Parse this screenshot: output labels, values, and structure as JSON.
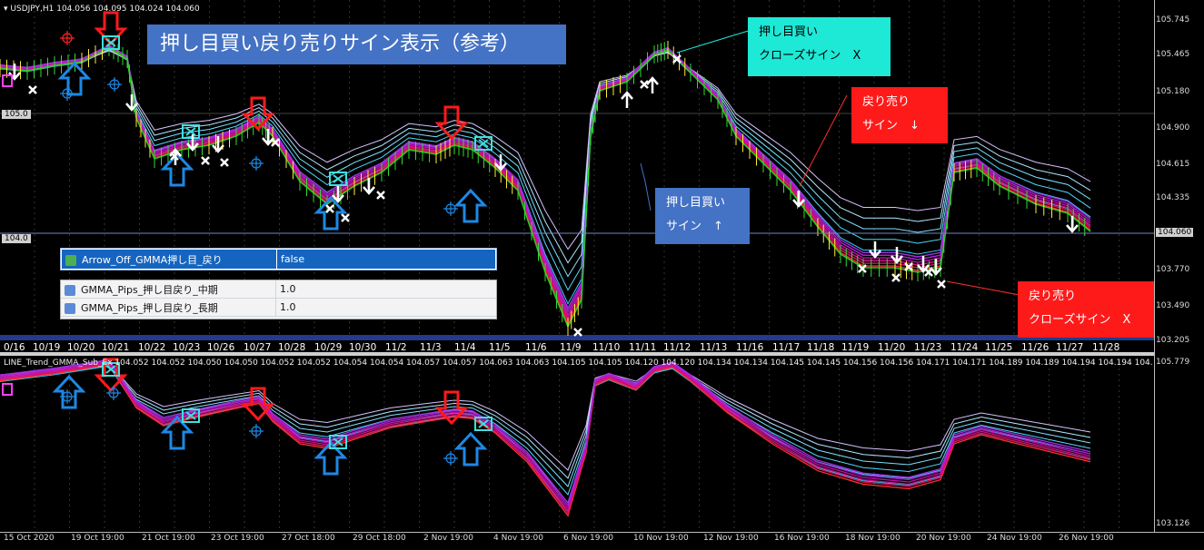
{
  "chart_header": "USDJPY,H1  104.056 104.095 104.024 104.060",
  "sub_header": "LINE_Trend_GMMA_Sub_Ex",
  "sub_values": "104.052 104.052 104.050 104.050 104.052 104.052 104.054 104.054 104.057 104.057 104.063 104.063 104.105 104.105 104.120 104.120 104.134 104.134 104.145 104.145 104.156 104.156 104.171 104.171 104.189 104.189 104.194 104.194 104.",
  "title": "押し目買い戻り売りサイン表示（参考）",
  "callouts": {
    "buy_close": [
      "押し目買い",
      "クローズサイン　X"
    ],
    "sell_sign": [
      "戻り売り",
      "サイン　↓"
    ],
    "buy_sign": [
      "押し目買い",
      "サイン　↑"
    ],
    "sell_close": [
      "戻り売り",
      "クローズサイン　X"
    ]
  },
  "props": {
    "arrow_off": {
      "name": "Arrow_Off_GMMA押し目_戻り",
      "value": "false"
    },
    "mid": {
      "name": "GMMA_Pips_押し目戻り_中期",
      "value": "1.0"
    },
    "long": {
      "name": "GMMA_Pips_押し目戻り_長期",
      "value": "1.0"
    }
  },
  "level_labels": {
    "l105": "105.0",
    "l104": "104.0"
  },
  "price_scale": [
    "105.745",
    "105.465",
    "105.180",
    "104.900",
    "104.615",
    "104.335",
    "104.060",
    "103.770",
    "103.490",
    "103.205"
  ],
  "sub_scale": [
    "105.779",
    "103.126"
  ],
  "date_labels": [
    "0/16",
    "10/19",
    "10/20",
    "10/21",
    "10/22",
    "10/23",
    "10/26",
    "10/27",
    "10/28",
    "10/29",
    "10/30",
    "11/2",
    "11/3",
    "11/4",
    "11/5",
    "11/6",
    "11/9",
    "11/10",
    "11/11",
    "11/12",
    "11/13",
    "11/16",
    "11/17",
    "11/18",
    "11/19",
    "11/20",
    "11/23",
    "11/24",
    "11/25",
    "11/26",
    "11/27",
    "11/28"
  ],
  "time_labels": [
    "15 Oct 2020",
    "19 Oct 19:00",
    "21 Oct 19:00",
    "23 Oct 19:00",
    "27 Oct 18:00",
    "29 Oct 18:00",
    "2 Nov 19:00",
    "4 Nov 19:00",
    "6 Nov 19:00",
    "10 Nov 19:00",
    "12 Nov 19:00",
    "16 Nov 19:00",
    "18 Nov 19:00",
    "20 Nov 19:00",
    "24 Nov 19:00",
    "26 Nov 19:00"
  ],
  "colors": {
    "title_bg": "#4472c4",
    "cyan_callout": "#1de9d6",
    "red_callout": "#ff1a1a",
    "blue_callout": "#4472c4",
    "sell_arrow": "#ff1a1a",
    "buy_arrow": "#1e88e5",
    "gmma_short": "#ff00ff",
    "gmma_long": "#00e5ff"
  },
  "icons": [
    "white-down-arrow-icon",
    "white-up-arrow-icon",
    "white-x-icon",
    "red-down-arrow-icon",
    "blue-up-arrow-icon",
    "cyan-x-box-icon",
    "crosshair-icon",
    "setting-icon"
  ]
}
